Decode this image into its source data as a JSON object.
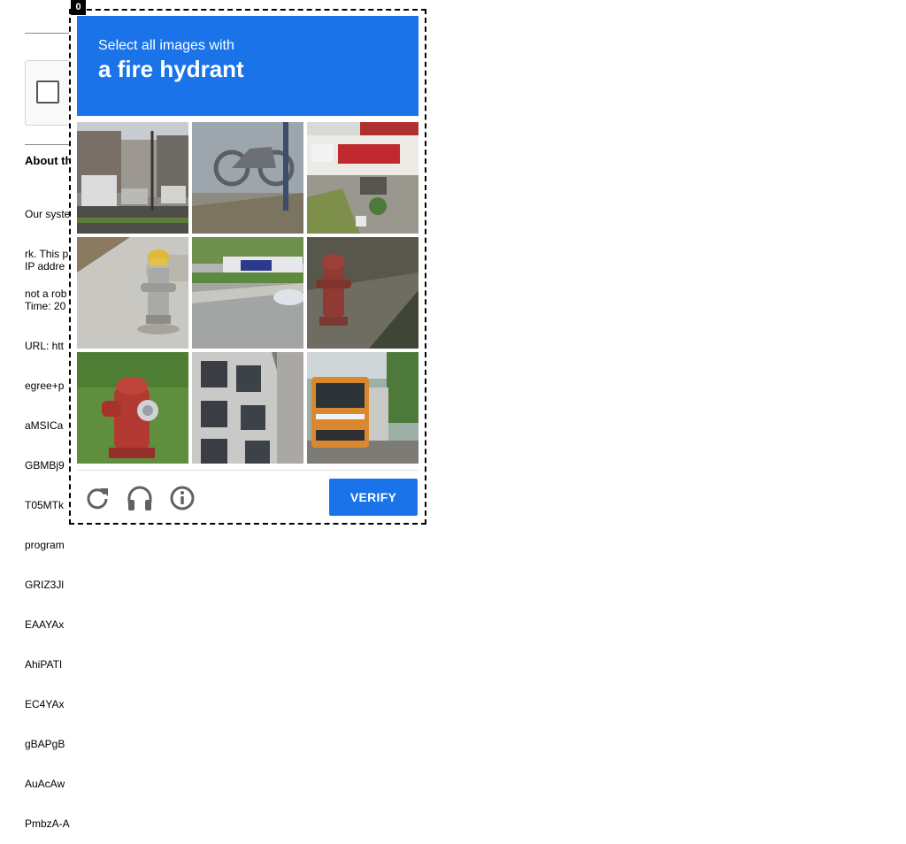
{
  "background": {
    "about_title": "About th",
    "about_lines": [
      "Our syste",
      "rk. This p",
      "not a rob"
    ],
    "info_lines": [
      "IP addre",
      "Time: 20",
      "URL: htt",
      "egree+p",
      "aMSICa",
      "GBMBj9",
      "T05MTk",
      "program",
      "GRIZ3Jl",
      "EAAYAx",
      "AhiPATI",
      "EC4YAx",
      "gBAPgB",
      "AuAcAw",
      "PmbzA-A"
    ]
  },
  "challenge": {
    "frame_index": "0",
    "instruction": "Select all images with",
    "target": "a fire hydrant",
    "tiles": [
      {
        "name": "tile-street-cars"
      },
      {
        "name": "tile-motorcycle-mural"
      },
      {
        "name": "tile-storefront"
      },
      {
        "name": "tile-hydrant-yellow-cap"
      },
      {
        "name": "tile-road-bus"
      },
      {
        "name": "tile-hydrant-red-dirt"
      },
      {
        "name": "tile-hydrant-red-grass"
      },
      {
        "name": "tile-building"
      },
      {
        "name": "tile-bus-front"
      }
    ],
    "footer": {
      "reload_icon": "reload-icon",
      "audio_icon": "headphones-icon",
      "info_icon": "info-icon",
      "verify_label": "VERIFY"
    },
    "colors": {
      "accent": "#1a73e8"
    }
  }
}
